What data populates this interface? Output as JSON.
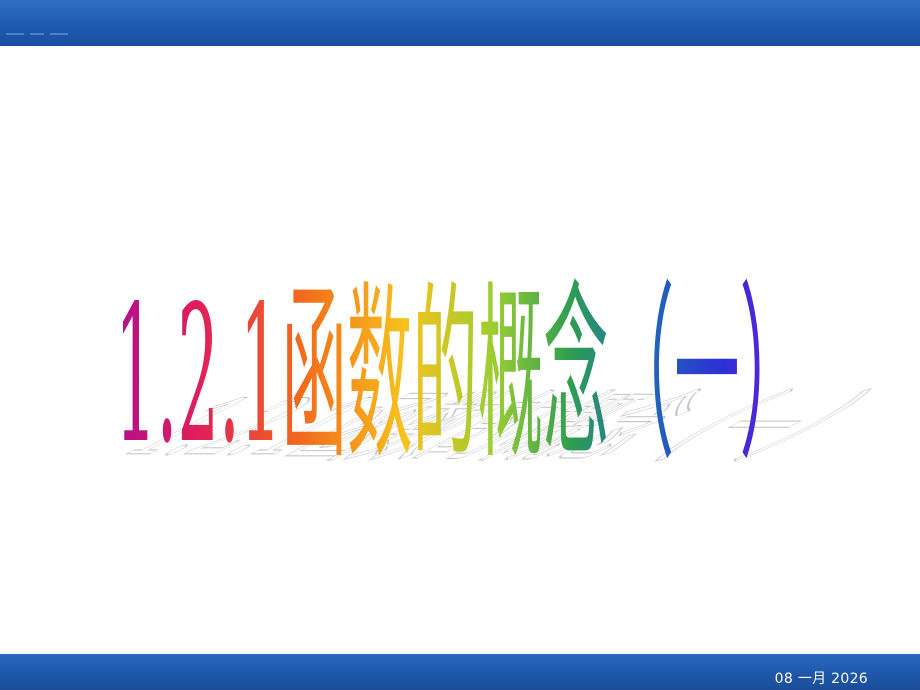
{
  "slide": {
    "title": "1.2.1函数的概念（一）",
    "footer_date": "08 一月 2026"
  },
  "colors": {
    "bar_blue": "#1f5bb0",
    "title_gradient": [
      "#b0108c",
      "#e01e5a",
      "#f26a1b",
      "#f7c21c",
      "#9acd32",
      "#2e9e4f",
      "#1f6fb5",
      "#2d2fd6",
      "#7a1fd6"
    ],
    "shadow": "#b8b8b8"
  }
}
